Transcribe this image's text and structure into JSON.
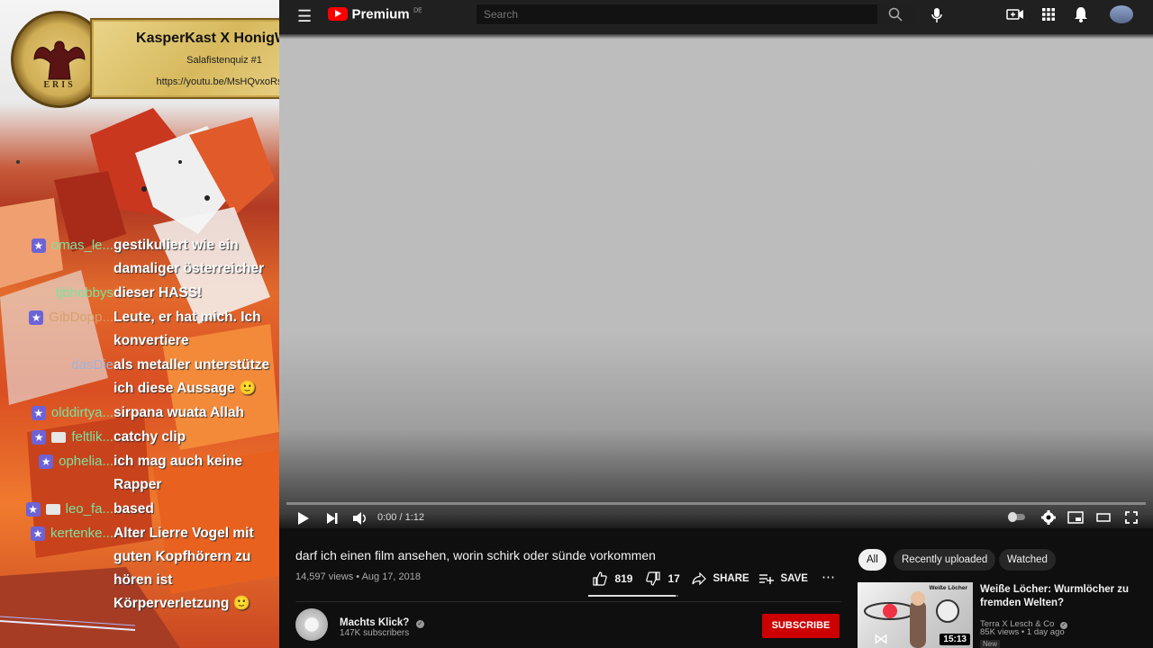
{
  "overlay": {
    "banner_title": "KasperKast X HonigWabe",
    "banner_subtitle": "Salafistenquiz #1",
    "banner_url": "https://youtu.be/MsHQvxoRszs",
    "logo_text": "ERIS"
  },
  "chat": [
    {
      "user": "omas_le...",
      "text": "gestikuliert wie ein damaliger österreicher",
      "color": "#79e39d",
      "badges": [
        "star"
      ]
    },
    {
      "user": "tjbhobbys",
      "text": "dieser HASS!",
      "color": "#79e39d",
      "badges": []
    },
    {
      "user": "GibDopp...",
      "text": "Leute, er hat mich. Ich konvertiere",
      "color": "#d8a06a",
      "badges": [
        "star"
      ]
    },
    {
      "user": "dasDie",
      "text": "als metaller unterstütze ich diese Aussage 🙂",
      "color": "#9fb3d8",
      "badges": []
    },
    {
      "user": "olddirtya...",
      "text": "sirpana wuata Allah",
      "color": "#79e39d",
      "badges": [
        "star"
      ]
    },
    {
      "user": "feltlik...",
      "text": "catchy clip",
      "color": "#79e39d",
      "badges": [
        "star",
        "box"
      ]
    },
    {
      "user": "ophelia...",
      "text": "ich mag auch keine Rapper",
      "color": "#79e39d",
      "badges": [
        "star"
      ]
    },
    {
      "user": "leo_fa...",
      "text": "based",
      "color": "#79e39d",
      "badges": [
        "star",
        "box"
      ]
    },
    {
      "user": "kertenke...",
      "text": "Alter Lierre Vogel mit guten Kopfhörern zu hören ist Körperverletzung 🙂",
      "color": "#79e39d",
      "badges": [
        "star"
      ]
    }
  ],
  "youtube": {
    "logo_label": "Premium",
    "logo_region": "DE",
    "search_placeholder": "Search",
    "player": {
      "time": "0:00 / 1:12",
      "progress": 0.0
    },
    "video": {
      "title": "darf ich einen film ansehen, worin schirk oder sünde vorkommen",
      "meta": "14,597 views • Aug 17, 2018",
      "likes": "819",
      "dislikes": "17",
      "share_label": "SHARE",
      "save_label": "SAVE",
      "more": "⋯"
    },
    "channel": {
      "name": "Machts Klick?",
      "subscribers": "147K subscribers",
      "subscribe_label": "SUBSCRIBE"
    },
    "chips": [
      "All",
      "Recently uploaded",
      "Watched"
    ],
    "recommended": {
      "title": "Weiße Löcher: Wurmlöcher zu fremden Welten?",
      "channel": "Terra X Lesch & Co",
      "meta": "85K views • 1 day ago",
      "badge": "New",
      "duration": "15:13",
      "thumb_caption": "Weiße Löcher"
    }
  }
}
